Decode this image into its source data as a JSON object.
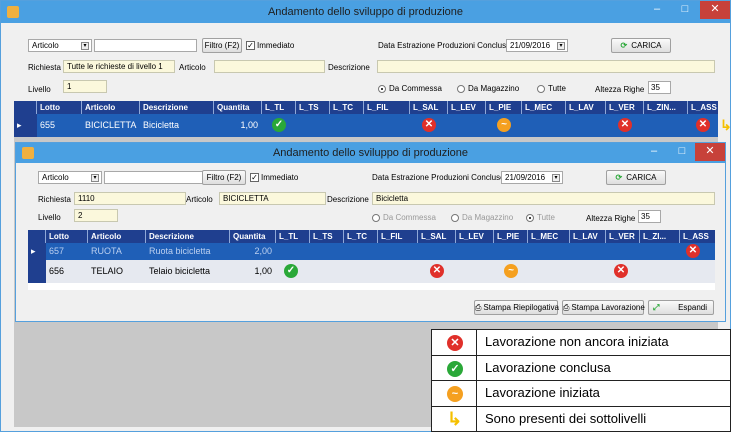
{
  "outer": {
    "title": "Andamento dello sviluppo di produzione",
    "articolo_select": "Articolo",
    "filtro_button": "Filtro (F2)",
    "immediato_label": "Immediato",
    "richiesta_label": "Richiesta",
    "richiesta_value": "Tutte le richieste di livello 1",
    "articolo_label": "Articolo",
    "descrizione_label": "Descrizione",
    "livello_label": "Livello",
    "livello_value": "1",
    "data_estrazione_label": "Data Estrazione Produzioni Concluse",
    "data_estrazione_value": "21/09/2016",
    "carica_button": "CARICA",
    "radio_commessa": "Da Commessa",
    "radio_magazzino": "Da Magazzino",
    "radio_tutte": "Tutte",
    "altezza_righe_label": "Altezza Righe",
    "altezza_righe_value": "35",
    "columns": [
      "Lotto",
      "Articolo",
      "Descrizione",
      "Quantita",
      "L_TL",
      "L_TS",
      "L_TC",
      "L_FIL",
      "L_SAL",
      "L_LEV",
      "L_PIE",
      "L_MEC",
      "L_LAV",
      "L_VER",
      "L_ZIN...",
      "L_ASS"
    ],
    "rows": [
      {
        "lotto": "655",
        "articolo": "BICICLETTA",
        "descrizione": "Bicicletta",
        "quantita": "1,00"
      }
    ]
  },
  "inner": {
    "title": "Andamento dello sviluppo di produzione",
    "articolo_select": "Articolo",
    "filtro_button": "Filtro (F2)",
    "immediato_label": "Immediato",
    "richiesta_label": "Richiesta",
    "richiesta_value": "1110",
    "articolo_label": "Articolo",
    "articolo_value": "BICICLETTA",
    "descrizione_label": "Descrizione",
    "descrizione_value": "Bicicletta",
    "livello_label": "Livello",
    "livello_value": "2",
    "data_estrazione_label": "Data Estrazione Produzioni Concluse",
    "data_estrazione_value": "21/09/2016",
    "carica_button": "CARICA",
    "radio_commessa": "Da Commessa",
    "radio_magazzino": "Da Magazzino",
    "radio_tutte": "Tutte",
    "altezza_righe_label": "Altezza Righe",
    "altezza_righe_value": "35",
    "columns": [
      "Lotto",
      "Articolo",
      "Descrizione",
      "Quantita",
      "L_TL",
      "L_TS",
      "L_TC",
      "L_FIL",
      "L_SAL",
      "L_LEV",
      "L_PIE",
      "L_MEC",
      "L_LAV",
      "L_VER",
      "L_ZI...",
      "L_ASS"
    ],
    "rows": [
      {
        "lotto": "657",
        "articolo": "RUOTA",
        "descrizione": "Ruota bicicletta",
        "quantita": "2,00"
      },
      {
        "lotto": "656",
        "articolo": "TELAIO",
        "descrizione": "Telaio bicicletta",
        "quantita": "1,00"
      }
    ],
    "stampa_riepilogativa": "Stampa Riepilogativa",
    "stampa_lavorazione": "Stampa Lavorazione",
    "espandi": "Espandi"
  },
  "legend": {
    "items": [
      {
        "icon": "red-x-icon",
        "text": "Lavorazione non ancora iniziata"
      },
      {
        "icon": "green-check-icon",
        "text": "Lavorazione conclusa"
      },
      {
        "icon": "orange-wave-icon",
        "text": "Lavorazione iniziata"
      },
      {
        "icon": "yellow-arrow-icon",
        "text": "Sono presenti dei sottolivelli"
      }
    ]
  },
  "colors": {
    "titlebar": "#4aa0e2",
    "grid_header": "#1f3f8f",
    "selected_row": "#1f5fb7",
    "red": "#e0302a",
    "green": "#2aa838",
    "orange": "#f5a020"
  }
}
